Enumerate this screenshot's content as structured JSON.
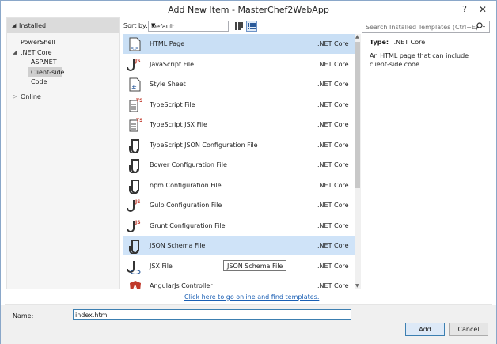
{
  "window": {
    "title": "Add New Item - MasterChef2WebApp",
    "help_glyph": "?",
    "close_glyph": "✕"
  },
  "left_panel": {
    "installed_label": "Installed",
    "tree": [
      {
        "label": "PowerShell"
      },
      {
        "label": ".NET Core"
      },
      {
        "label": "ASP.NET"
      },
      {
        "label": "Client-side"
      },
      {
        "label": "Code"
      },
      {
        "label": "Online"
      }
    ]
  },
  "toolbar": {
    "sort_label": "Sort by:",
    "sort_value": "Default"
  },
  "search": {
    "placeholder": "Search Installed Templates (Ctrl+E)"
  },
  "templates": [
    {
      "name": "HTML Page",
      "framework": ".NET Core",
      "icon": "html-file-icon"
    },
    {
      "name": "JavaScript File",
      "framework": ".NET Core",
      "icon": "javascript-file-icon"
    },
    {
      "name": "Style Sheet",
      "framework": ".NET Core",
      "icon": "stylesheet-file-icon"
    },
    {
      "name": "TypeScript File",
      "framework": ".NET Core",
      "icon": "typescript-file-icon"
    },
    {
      "name": "TypeScript JSX File",
      "framework": ".NET Core",
      "icon": "typescript-jsx-file-icon"
    },
    {
      "name": "TypeScript JSON Configuration File",
      "framework": ".NET Core",
      "icon": "json-config-file-icon"
    },
    {
      "name": "Bower Configuration File",
      "framework": ".NET Core",
      "icon": "bower-config-file-icon"
    },
    {
      "name": "npm Configuration File",
      "framework": ".NET Core",
      "icon": "npm-config-file-icon"
    },
    {
      "name": "Gulp Configuration File",
      "framework": ".NET Core",
      "icon": "gulp-config-file-icon"
    },
    {
      "name": "Grunt Configuration File",
      "framework": ".NET Core",
      "icon": "grunt-config-file-icon"
    },
    {
      "name": "JSON Schema File",
      "framework": ".NET Core",
      "icon": "json-schema-file-icon"
    },
    {
      "name": "JSX File",
      "framework": ".NET Core",
      "icon": "jsx-file-icon"
    },
    {
      "name": "AngularJs Controller",
      "framework": ".NET Core",
      "icon": "angular-controller-icon"
    }
  ],
  "tooltip": "JSON Schema File",
  "details": {
    "type_label": "Type:",
    "type_value": ".NET Core",
    "description": "An HTML page that can include client-side code"
  },
  "online_link": "Click here to go online and find templates.",
  "bottom": {
    "name_label": "Name:",
    "name_value": "index.html",
    "add_label": "Add",
    "cancel_label": "Cancel"
  },
  "colors": {
    "selected_row": "#c9dff5",
    "accent": "#3c7fb1",
    "link": "#1a5fb4"
  }
}
